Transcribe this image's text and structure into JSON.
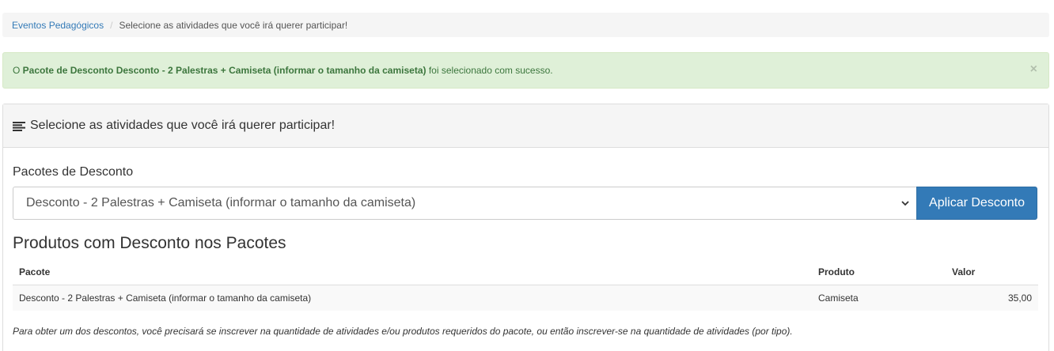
{
  "breadcrumb": {
    "root": "Eventos Pedagógicos",
    "separator": "/",
    "current": "Selecione as atividades que você irá querer participar!"
  },
  "alert": {
    "prefix": "O ",
    "bold": "Pacote de Desconto Desconto - 2 Palestras + Camiseta (informar o tamanho da camiseta)",
    "suffix": " foi selecionado com sucesso.",
    "close": "×"
  },
  "panel": {
    "heading": "Selecione as atividades que você irá querer participar!",
    "pacotes_label": "Pacotes de Desconto",
    "select_value": "Desconto - 2 Palestras + Camiseta (informar o tamanho da camiseta)",
    "apply_button": "Aplicar Desconto",
    "section_title": "Produtos com Desconto nos Pacotes",
    "table": {
      "headers": [
        "Pacote",
        "Produto",
        "Valor"
      ],
      "rows": [
        [
          "Desconto - 2 Palestras + Camiseta (informar o tamanho da camiseta)",
          "Camiseta",
          "35,00"
        ]
      ]
    },
    "note": "Para obter um dos descontos, você precisará se inscrever na quantidade de atividades e/ou produtos requeridos do pacote, ou então inscrever-se na quantidade de atividades (por tipo)."
  },
  "icons": {
    "heading_icon": "list-icon",
    "select_icon": "chevron-down-icon"
  },
  "colors": {
    "link": "#337ab7",
    "alert_bg": "#dff0d8",
    "alert_text": "#3c763d",
    "primary_button": "#337ab7"
  }
}
